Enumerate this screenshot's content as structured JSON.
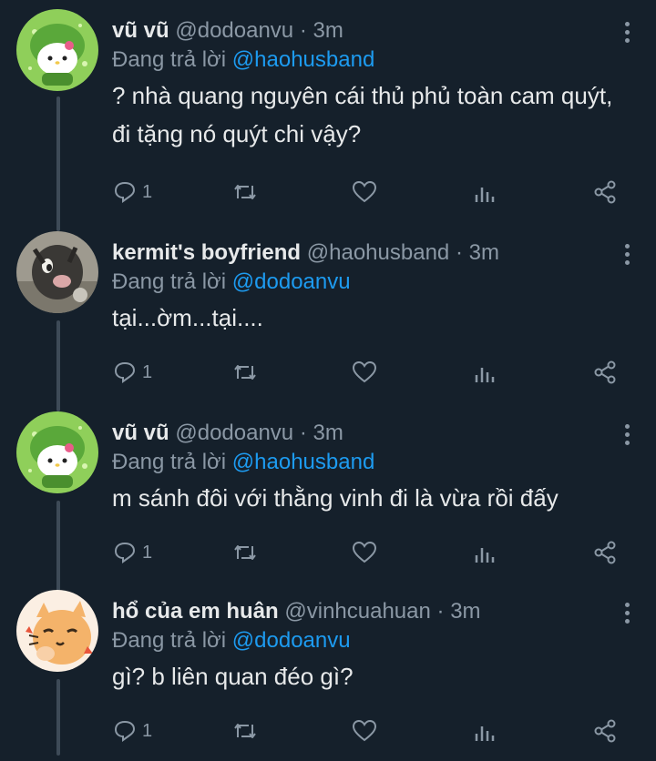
{
  "colors": {
    "background": "#15202b",
    "text": "#e7e9ea",
    "muted": "#8b98a5",
    "mention": "#1d9bf0",
    "thread_line": "#3d4a57"
  },
  "tweets": [
    {
      "name": "vũ vũ",
      "handle": "@dodoanvu",
      "dot": "·",
      "time": "3m",
      "reply_prefix": "Đang trả lời",
      "reply_to": "@haohusband",
      "text": "? nhà quang nguyên cái thủ phủ toàn cam quýt, đi tặng nó quýt chi vậy?",
      "reply_count": "1",
      "avatar": "hello-kitty-green-avatar"
    },
    {
      "name": "kermit's boyfriend",
      "handle": "@haohusband",
      "dot": "·",
      "time": "3m",
      "reply_prefix": "Đang trả lời",
      "reply_to": "@dodoanvu",
      "text": "tại...ờm...tại....",
      "reply_count": "1",
      "avatar": "cat-photo-avatar"
    },
    {
      "name": "vũ vũ",
      "handle": "@dodoanvu",
      "dot": "·",
      "time": "3m",
      "reply_prefix": "Đang trả lời",
      "reply_to": "@haohusband",
      "text": "m sánh đôi với thằng vinh đi là vừa rồi đấy",
      "reply_count": "1",
      "avatar": "hello-kitty-green-avatar"
    },
    {
      "name": "hổ của em huân",
      "handle": "@vinhcuahuan",
      "dot": "·",
      "time": "3m",
      "reply_prefix": "Đang trả lời",
      "reply_to": "@dodoanvu",
      "text": "gì? b liên quan đéo gì?",
      "reply_count": "1",
      "avatar": "orange-cat-drawing-avatar"
    }
  ]
}
